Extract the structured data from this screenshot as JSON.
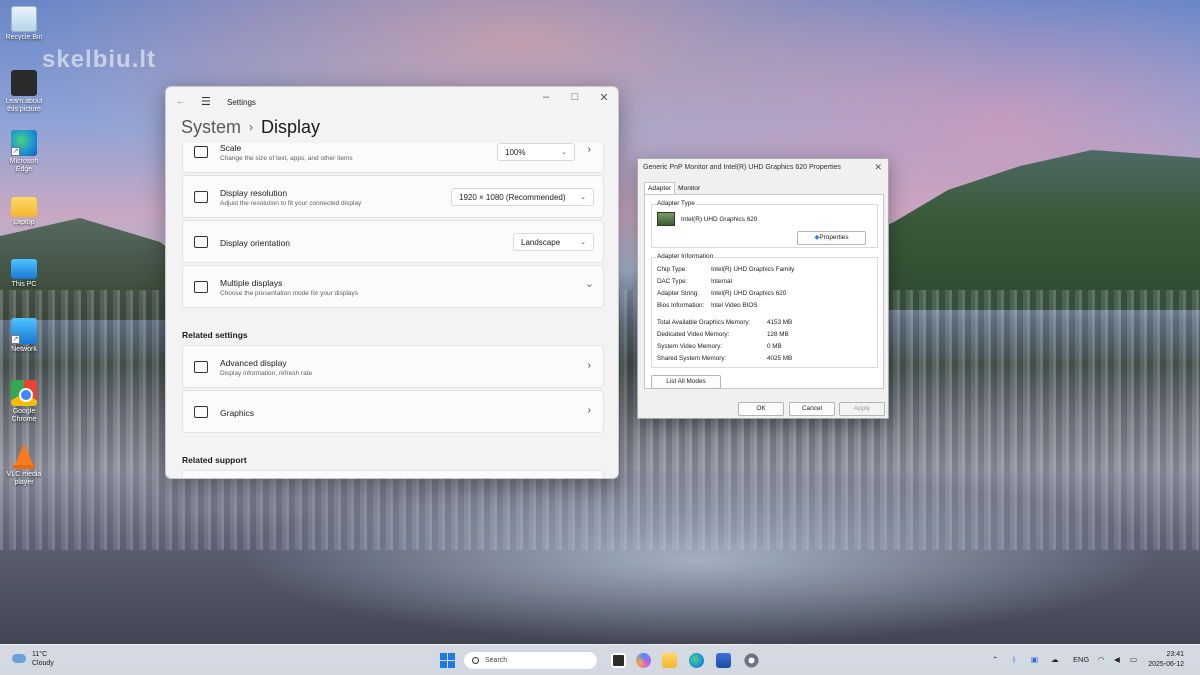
{
  "watermark": "skelbiu.lt",
  "desktop_icons": [
    {
      "label": "Recycle Bin"
    },
    {
      "label": "Learn about this picture"
    },
    {
      "label": "Microsoft Edge"
    },
    {
      "label": "Laptop"
    },
    {
      "label": "This PC"
    },
    {
      "label": "Network"
    },
    {
      "label": "Google Chrome"
    },
    {
      "label": "VLC media player"
    }
  ],
  "settings": {
    "window_title": "Settings",
    "breadcrumb_parent": "System",
    "breadcrumb_current": "Display",
    "cards": [
      {
        "title": "Scale",
        "subtitle": "Change the size of text, apps, and other items",
        "value": "100%"
      },
      {
        "title": "Display resolution",
        "subtitle": "Adjust the resolution to fit your connected display",
        "value": "1920 × 1080 (Recommended)"
      },
      {
        "title": "Display orientation",
        "subtitle": "",
        "value": "Landscape"
      },
      {
        "title": "Multiple displays",
        "subtitle": "Choose the presentation mode for your displays"
      }
    ],
    "related_settings_title": "Related settings",
    "related_settings": [
      {
        "title": "Advanced display",
        "subtitle": "Display information, refresh rate"
      },
      {
        "title": "Graphics",
        "subtitle": ""
      }
    ],
    "related_support_title": "Related support"
  },
  "properties": {
    "title": "Generic PnP Monitor and Intel(R) UHD Graphics 620 Properties",
    "tabs": [
      "Adapter",
      "Monitor"
    ],
    "adapter_type_label": "Adapter Type",
    "adapter_name": "Intel(R) UHD Graphics 620",
    "properties_button": "Properties",
    "adapter_info_label": "Adapter Information",
    "info": [
      {
        "key": "Chip Type:",
        "value": "Intel(R) UHD Graphics Family"
      },
      {
        "key": "DAC Type:",
        "value": "Internal"
      },
      {
        "key": "Adapter String:",
        "value": "Intel(R) UHD Graphics 620"
      },
      {
        "key": "Bios Information:",
        "value": "Intel Video BIOS"
      }
    ],
    "memory": [
      {
        "key": "Total Available Graphics Memory:",
        "value": "4153 MB"
      },
      {
        "key": "Dedicated Video Memory:",
        "value": "128 MB"
      },
      {
        "key": "System Video Memory:",
        "value": "0 MB"
      },
      {
        "key": "Shared System Memory:",
        "value": "4025 MB"
      }
    ],
    "list_all_modes": "List All Modes",
    "ok": "OK",
    "cancel": "Cancel",
    "apply": "Apply"
  },
  "taskbar": {
    "temperature": "11°C",
    "condition": "Cloudy",
    "search_placeholder": "Search",
    "language": "ENG",
    "time": "23:41",
    "date": "2025-06-12"
  }
}
